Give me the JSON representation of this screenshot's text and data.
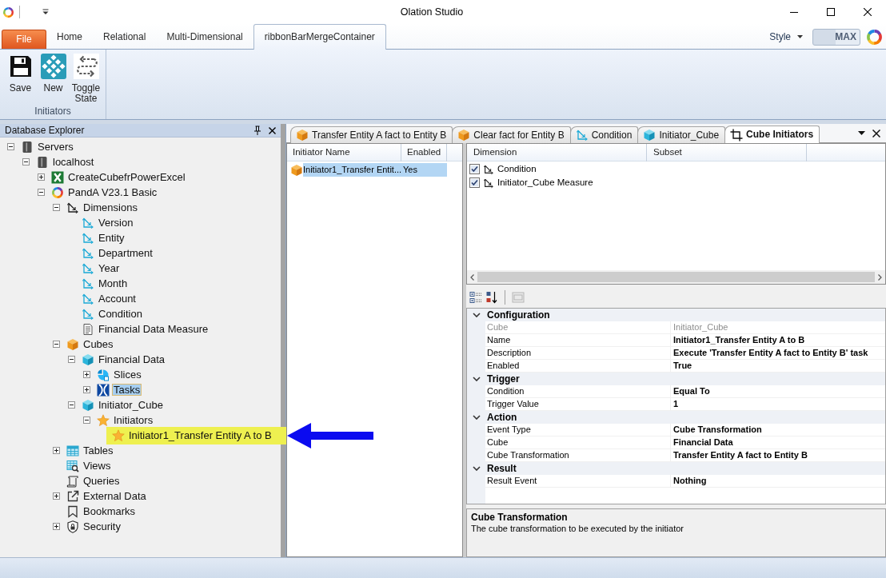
{
  "window": {
    "title": "Olation Studio"
  },
  "ribbon": {
    "tabs": [
      {
        "label": "File",
        "kind": "file",
        "selected": false
      },
      {
        "label": "Home",
        "kind": "tab",
        "selected": false
      },
      {
        "label": "Relational",
        "kind": "tab",
        "selected": false
      },
      {
        "label": "Multi-Dimensional",
        "kind": "tab",
        "selected": false
      },
      {
        "label": "ribbonBarMergeContainer",
        "kind": "tab",
        "selected": true
      }
    ],
    "style_menu": {
      "label": "Style"
    },
    "mode_toggle": {
      "label": "MAX"
    },
    "groups": [
      {
        "label": "Initiators",
        "buttons": [
          {
            "label": "Save",
            "kind": "save"
          },
          {
            "label": "New",
            "kind": "new"
          },
          {
            "label": "Toggle State",
            "kind": "toggle"
          }
        ]
      }
    ]
  },
  "explorer": {
    "title": "Database Explorer",
    "tree": [
      {
        "label": "Servers",
        "kind": "server",
        "expanded": true,
        "selected": false,
        "children": [
          {
            "label": "localhost",
            "kind": "server",
            "expanded": true,
            "selected": false,
            "children": [
              {
                "label": "CreateCubefrPowerExcel",
                "kind": "spreadsheet-db",
                "expanded": false,
                "selected": false
              },
              {
                "label": "PandA V23.1 Basic",
                "kind": "ring-db",
                "expanded": true,
                "selected": false,
                "children": [
                  {
                    "label": "Dimensions",
                    "kind": "dimension-folder",
                    "expanded": true,
                    "selected": false,
                    "children": [
                      {
                        "label": "Version",
                        "kind": "dimension",
                        "selected": false
                      },
                      {
                        "label": "Entity",
                        "kind": "dimension",
                        "selected": false
                      },
                      {
                        "label": "Department",
                        "kind": "dimension",
                        "selected": false
                      },
                      {
                        "label": "Year",
                        "kind": "dimension",
                        "selected": false
                      },
                      {
                        "label": "Month",
                        "kind": "dimension",
                        "selected": false
                      },
                      {
                        "label": "Account",
                        "kind": "dimension",
                        "selected": false
                      },
                      {
                        "label": "Condition",
                        "kind": "dimension",
                        "selected": false
                      },
                      {
                        "label": "Financial Data Measure",
                        "kind": "measure",
                        "selected": false
                      }
                    ]
                  },
                  {
                    "label": "Cubes",
                    "kind": "cube-folder",
                    "expanded": true,
                    "selected": false,
                    "children": [
                      {
                        "label": "Financial Data",
                        "kind": "cube",
                        "expanded": true,
                        "selected": false,
                        "children": [
                          {
                            "label": "Slices",
                            "kind": "slices",
                            "expanded": false,
                            "selected": false
                          },
                          {
                            "label": "Tasks",
                            "kind": "tasks",
                            "expanded": false,
                            "selected": true
                          }
                        ]
                      },
                      {
                        "label": "Initiator_Cube",
                        "kind": "cube",
                        "expanded": true,
                        "selected": false,
                        "children": [
                          {
                            "label": "Initiators",
                            "kind": "initiators",
                            "expanded": true,
                            "selected": false,
                            "children": [
                              {
                                "label": "Initiator1_Transfer Entity A to B",
                                "kind": "initiator",
                                "selected": false,
                                "highlighted": true
                              }
                            ]
                          }
                        ]
                      }
                    ]
                  },
                  {
                    "label": "Tables",
                    "kind": "tables",
                    "expanded": false,
                    "selected": false
                  },
                  {
                    "label": "Views",
                    "kind": "views",
                    "selected": false
                  },
                  {
                    "label": "Queries",
                    "kind": "queries",
                    "selected": false
                  },
                  {
                    "label": "External Data",
                    "kind": "external",
                    "expanded": false,
                    "selected": false
                  },
                  {
                    "label": "Bookmarks",
                    "kind": "bookmarks",
                    "selected": false
                  },
                  {
                    "label": "Security",
                    "kind": "security",
                    "expanded": false,
                    "selected": false
                  }
                ]
              }
            ]
          }
        ]
      }
    ]
  },
  "document_tabs": [
    {
      "label": "Transfer Entity A fact to Entity B",
      "kind": "task",
      "selected": false
    },
    {
      "label": "Clear fact for Entity B",
      "kind": "task",
      "selected": false
    },
    {
      "label": "Condition",
      "kind": "dimension",
      "selected": false
    },
    {
      "label": "Initiator_Cube",
      "kind": "cube",
      "selected": false
    },
    {
      "label": "Cube Initiators",
      "kind": "initiators",
      "selected": true
    }
  ],
  "initiator_list": {
    "columns": [
      "Initiator Name",
      "Enabled"
    ],
    "rows": [
      {
        "name": "Initiator1_Transfer Entit...",
        "enabled": "Yes",
        "selected": true
      }
    ]
  },
  "dimension_grid": {
    "columns": [
      "Dimension",
      "Subset"
    ],
    "rows": [
      {
        "name": "Condition",
        "checked": true
      },
      {
        "name": "Initiator_Cube Measure",
        "checked": true
      }
    ]
  },
  "property_grid": {
    "categories": [
      {
        "name": "Configuration",
        "expanded": true,
        "properties": [
          {
            "name": "Cube",
            "value": "Initiator_Cube",
            "readonly": true
          },
          {
            "name": "Name",
            "value": "Initiator1_Transfer Entity A to B",
            "readonly": false
          },
          {
            "name": "Description",
            "value": "Execute 'Transfer Entity A fact to Entity B' task",
            "readonly": false
          },
          {
            "name": "Enabled",
            "value": "True",
            "readonly": false
          }
        ]
      },
      {
        "name": "Trigger",
        "expanded": true,
        "properties": [
          {
            "name": "Condition",
            "value": "Equal To",
            "readonly": false
          },
          {
            "name": "Trigger Value",
            "value": "1",
            "readonly": false
          }
        ]
      },
      {
        "name": "Action",
        "expanded": true,
        "properties": [
          {
            "name": "Event Type",
            "value": "Cube Transformation",
            "readonly": false
          },
          {
            "name": "Cube",
            "value": "Financial Data",
            "readonly": false
          },
          {
            "name": "Cube Transformation",
            "value": "Transfer Entity A fact to Entity B",
            "readonly": false
          }
        ]
      },
      {
        "name": "Result",
        "expanded": true,
        "properties": [
          {
            "name": "Result Event",
            "value": "Nothing",
            "readonly": false
          }
        ]
      }
    ]
  },
  "description": {
    "title": "Cube Transformation",
    "text": "The cube transformation to be executed by the initiator"
  }
}
